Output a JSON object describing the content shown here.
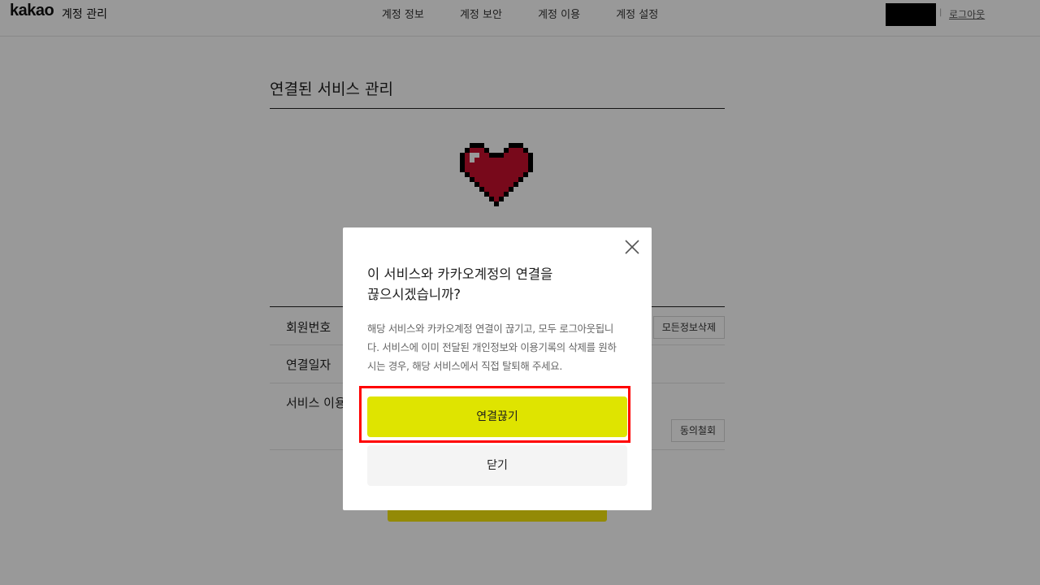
{
  "header": {
    "logo": "kakao",
    "logo_sub": "계정 관리",
    "nav": [
      "계정 정보",
      "계정 보안",
      "계정 이용",
      "계정 설정"
    ],
    "logout": "로그아웃"
  },
  "main": {
    "title": "연결된 서비스 관리",
    "rows": [
      {
        "label": "회원번호",
        "button": "모든정보삭제"
      },
      {
        "label": "연결일자"
      },
      {
        "label": "서비스 이용",
        "button": "동의철회"
      }
    ]
  },
  "modal": {
    "title_line1": "이 서비스와 카카오계정의 연결을",
    "title_line2": "끊으시겠습니까?",
    "desc_line1": "해당 서비스와 카카오계정 연결이 끊기고, 모두 로그아웃됩니",
    "desc_line2": "다. 서비스에 이미 전달된 개인정보와 이용기록의 삭제를 원하",
    "desc_line3": "시는 경우, 해당 서비스에서 직접 탈퇴해 주세요.",
    "confirm_label": "연결끊기",
    "cancel_label": "닫기",
    "close_icon": "close-icon"
  },
  "colors": {
    "primary": "#dfe400",
    "highlight": "#ff0000",
    "overlay": "rgba(0,0,0,0.4)"
  }
}
